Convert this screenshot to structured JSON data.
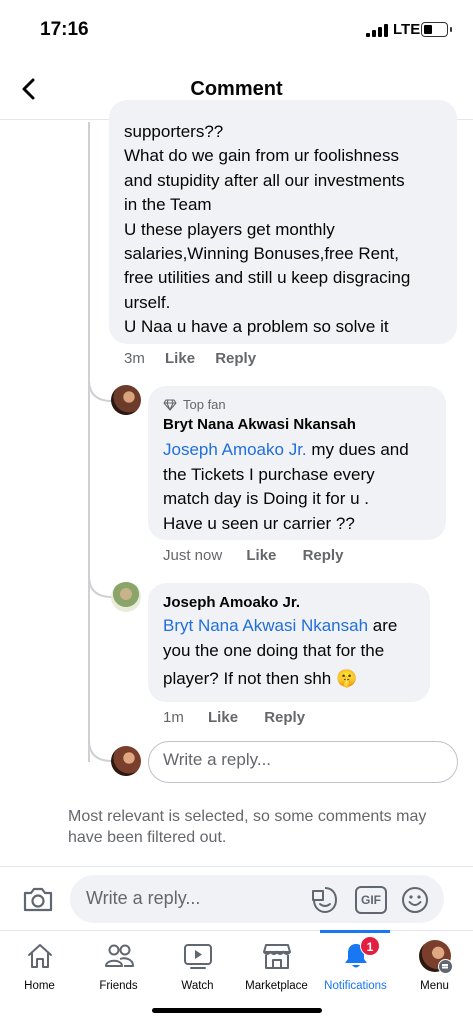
{
  "status_bar": {
    "time": "17:16",
    "network": "LTE"
  },
  "header": {
    "title": "Comment"
  },
  "main_comment": {
    "lines": [
      "supporters??",
      "What do we gain from ur foolishness",
      "and stupidity after all our investments",
      "in the Team",
      "U these players get monthly",
      "salaries,Winning Bonuses,free Rent,",
      "free utilities and still u keep disgracing",
      "urself.",
      "U Naa u have a problem so solve it"
    ],
    "time": "3m",
    "like": "Like",
    "reply": "Reply"
  },
  "replies": [
    {
      "badge": "Top fan",
      "name": "Bryt Nana Akwasi Nkansah",
      "mention": "Joseph Amoako Jr.",
      "line1_rest": " my dues and",
      "lines": [
        "the Tickets I purchase every",
        "match day is Doing it for u .",
        "Have u seen ur carrier ??"
      ],
      "time": "Just now",
      "like": "Like",
      "reply": "Reply"
    },
    {
      "name": "Joseph Amoako Jr.",
      "mention": "Bryt Nana Akwasi Nkansah",
      "line1_rest": " are",
      "lines": [
        "you the one doing that for the",
        "player? If not then shh 🤫"
      ],
      "time": "1m",
      "like": "Like",
      "reply": "Reply"
    }
  ],
  "inline_reply": {
    "placeholder": "Write a reply..."
  },
  "notice": "Most relevant is selected, so some comments may have been filtered out.",
  "composer": {
    "placeholder": "Write a reply...",
    "gif_label": "GIF"
  },
  "tabs": [
    {
      "label": "Home",
      "icon": "home-icon"
    },
    {
      "label": "Friends",
      "icon": "friends-icon"
    },
    {
      "label": "Watch",
      "icon": "watch-icon"
    },
    {
      "label": "Marketplace",
      "icon": "marketplace-icon"
    },
    {
      "label": "Notifications",
      "icon": "bell-icon",
      "badge": "1",
      "active": true
    },
    {
      "label": "Menu",
      "icon": "menu-icon"
    }
  ],
  "colors": {
    "accent": "#1877f2",
    "mention": "#216fdb",
    "badge": "#e41e3f",
    "bubble": "#f0f2f5",
    "secondary_text": "#65676b"
  }
}
